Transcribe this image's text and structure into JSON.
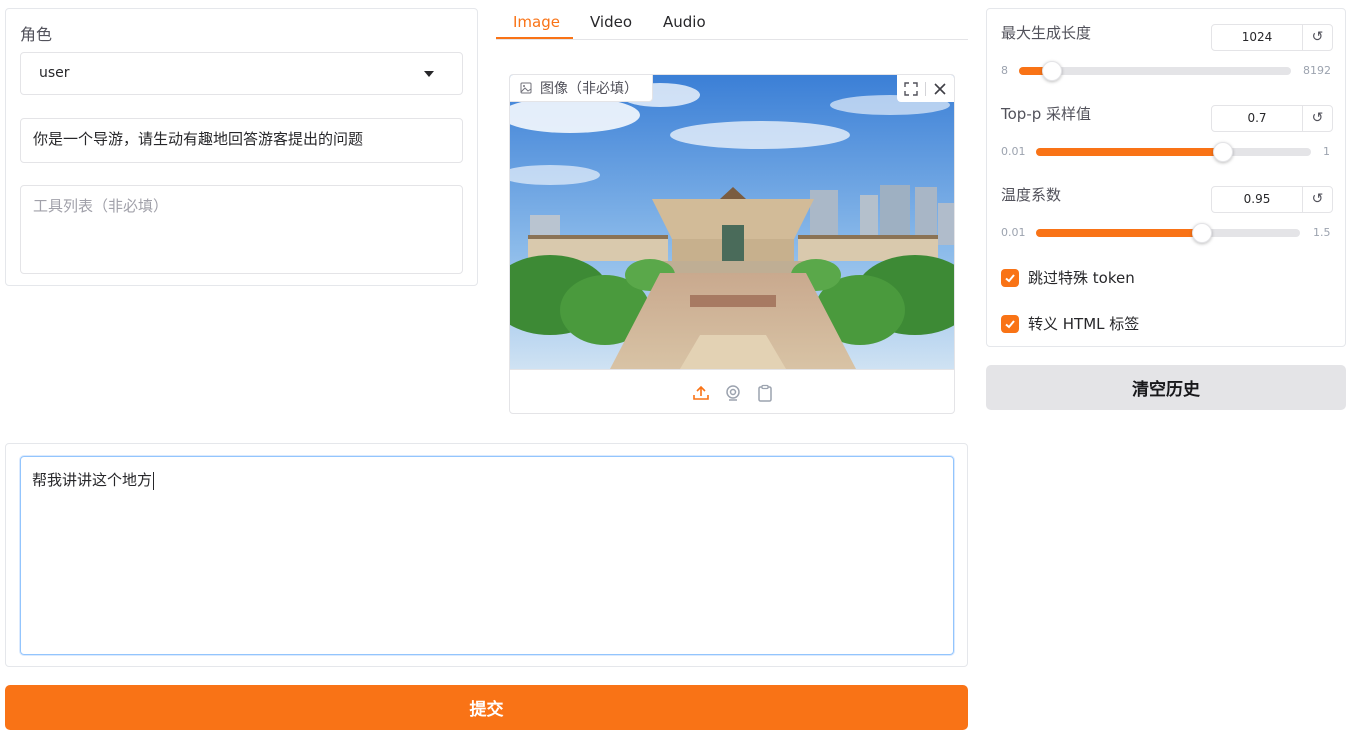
{
  "left": {
    "role_label": "角色",
    "role_value": "user",
    "system_prompt": "你是一个导游，请生动有趣地回答游客提出的问题",
    "tools_placeholder": "工具列表（非必填）"
  },
  "tabs": [
    "Image",
    "Video",
    "Audio"
  ],
  "image": {
    "label": "图像（非必填）"
  },
  "prompt": {
    "value": "帮我讲讲这个地方"
  },
  "submit_label": "提交",
  "params": {
    "max_len": {
      "label": "最大生成长度",
      "value": "1024",
      "min": "8",
      "max": "8192",
      "fraction": 0.12
    },
    "top_p": {
      "label": "Top-p 采样值",
      "value": "0.7",
      "min": "0.01",
      "max": "1",
      "fraction": 0.68
    },
    "temperature": {
      "label": "温度系数",
      "value": "0.95",
      "min": "0.01",
      "max": "1.5",
      "fraction": 0.63
    }
  },
  "checks": {
    "skip_special": "跳过特殊 token",
    "escape_html": "转义 HTML 标签"
  },
  "reset_icon": "↺",
  "clear_label": "清空历史",
  "accent_color": "#f97316"
}
